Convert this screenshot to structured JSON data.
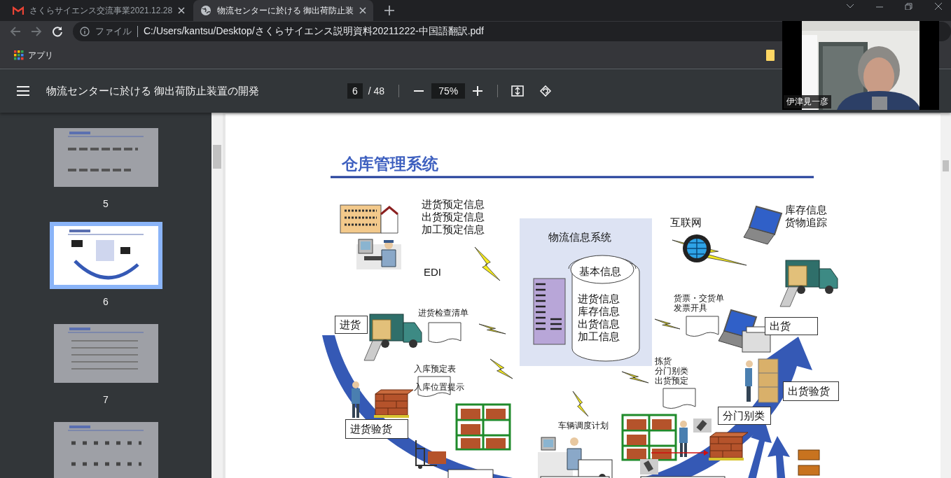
{
  "browser_tabs": [
    {
      "title": "さくらサイエンス交流事業2021.12.28",
      "kind": "mail",
      "selected": false
    },
    {
      "title": "物流センターに於ける 御出荷防止装",
      "kind": "globe",
      "selected": true
    }
  ],
  "address_bar": {
    "scheme": "ファイル",
    "url": "C:/Users/kantsu/Desktop/さくらサイエンス説明資料20211222-中国語翻訳.pdf"
  },
  "bookmarks": [
    {
      "label": "アプリ"
    }
  ],
  "pdf_toolbar": {
    "title": "物流センターに於ける 御出荷防止装置の開発",
    "page": "6",
    "page_count": "/ 48",
    "zoom": "75%"
  },
  "thumbnails": [
    {
      "page_label": "5",
      "selected": false
    },
    {
      "page_label": "6",
      "selected": true
    },
    {
      "page_label": "7",
      "selected": false
    },
    {
      "selected": false
    }
  ],
  "document": {
    "title": "仓库管理系统",
    "labels": [
      {
        "text": "进货预定信息",
        "kind": "text"
      },
      {
        "text": "出货预定信息",
        "kind": "text"
      },
      {
        "text": "加工预定信息",
        "kind": "text"
      },
      {
        "text": "EDI",
        "kind": "text"
      },
      {
        "text": "物流信息系统",
        "kind": "text"
      },
      {
        "text": "基本信息",
        "kind": "text"
      },
      {
        "text": "进货信息",
        "kind": "text"
      },
      {
        "text": "库存信息",
        "kind": "text"
      },
      {
        "text": "出货信息",
        "kind": "text"
      },
      {
        "text": "加工信息",
        "kind": "text"
      },
      {
        "text": "互联网",
        "kind": "text"
      },
      {
        "text": "库存信息",
        "kind": "text"
      },
      {
        "text": "货物追踪",
        "kind": "text"
      },
      {
        "text": "进货检查清单",
        "kind": "small"
      },
      {
        "text": "货票・交货单",
        "kind": "small"
      },
      {
        "text": "发票开具",
        "kind": "small"
      },
      {
        "text": "进货",
        "kind": "boxed"
      },
      {
        "text": "出货",
        "kind": "boxed"
      },
      {
        "text": "入库预定表",
        "kind": "small"
      },
      {
        "text": "入库位置提示",
        "kind": "small"
      },
      {
        "text": "拣货",
        "kind": "small"
      },
      {
        "text": "分门别类",
        "kind": "small"
      },
      {
        "text": "出货预定",
        "kind": "small"
      },
      {
        "text": "出货验货",
        "kind": "boxed"
      },
      {
        "text": "进货验货",
        "kind": "boxed"
      },
      {
        "text": "车辆调度计划",
        "kind": "small"
      },
      {
        "text": "分门别类",
        "kind": "boxed"
      }
    ]
  },
  "video_call": {
    "name": "伊津見一彦",
    "kind": "picture"
  }
}
